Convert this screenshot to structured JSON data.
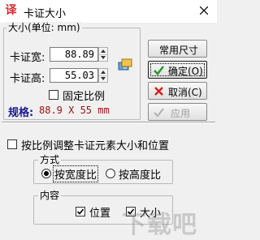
{
  "window": {
    "icon_glyph": "译",
    "title": "卡证大小",
    "close_glyph": "close-icon"
  },
  "size_group": {
    "legend": "大小(单位: mm)",
    "width_label": "卡证宽:",
    "width_value": "88.89",
    "height_label": "卡证高:",
    "height_value": "55.03",
    "fixed_ratio_label": "固定比例",
    "fixed_ratio_checked": false,
    "spec_label": "规格:",
    "spec_value": "88.9 X 55 mm"
  },
  "buttons": {
    "common_sizes": "常用尺寸",
    "ok": "确定(O)",
    "cancel": "取消(C)",
    "apply": "应用"
  },
  "scale_elements": {
    "checkbox_label": "按比例调整卡证元素大小和位置",
    "checked": false
  },
  "mode_group": {
    "legend": "方式",
    "by_width": "按宽度比",
    "by_height": "按高度比",
    "selected": "by_width"
  },
  "content_group": {
    "legend": "内容",
    "position_label": "位置",
    "position_checked": true,
    "size_label": "大小",
    "size_checked": true
  },
  "watermark_text": "下载吧",
  "colors": {
    "spec_label": "#1a1a8c",
    "spec_value": "#9a1010",
    "ok_check": "#2a9a2a",
    "cancel_x": "#d02020"
  }
}
